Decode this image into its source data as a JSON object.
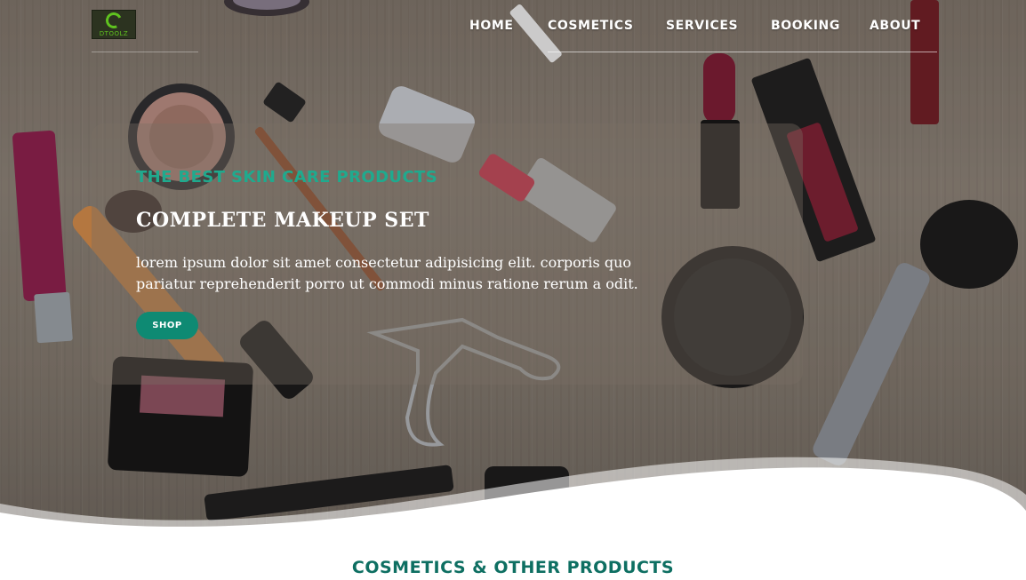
{
  "brand": {
    "logo_text": "DTOOLZ"
  },
  "nav": {
    "items": [
      {
        "label": "HOME"
      },
      {
        "label": "COSMETICS"
      },
      {
        "label": "SERVICES"
      },
      {
        "label": "BOOKING"
      },
      {
        "label": "ABOUT"
      }
    ]
  },
  "hero": {
    "kicker": "THE BEST SKIN CARE PRODUCTS",
    "title": "COMPLETE MAKEUP SET",
    "description": "lorem ipsum dolor sit amet consectetur adipisicing elit. corporis quo pariatur reprehenderit porro ut commodi minus ratione rerum a odit.",
    "cta_label": "SHOP"
  },
  "section": {
    "title": "COSMETICS & OTHER PRODUCTS"
  },
  "colors": {
    "accent": "#0e8a73",
    "kicker": "#1faa8e",
    "section_title": "#0e6f62"
  }
}
